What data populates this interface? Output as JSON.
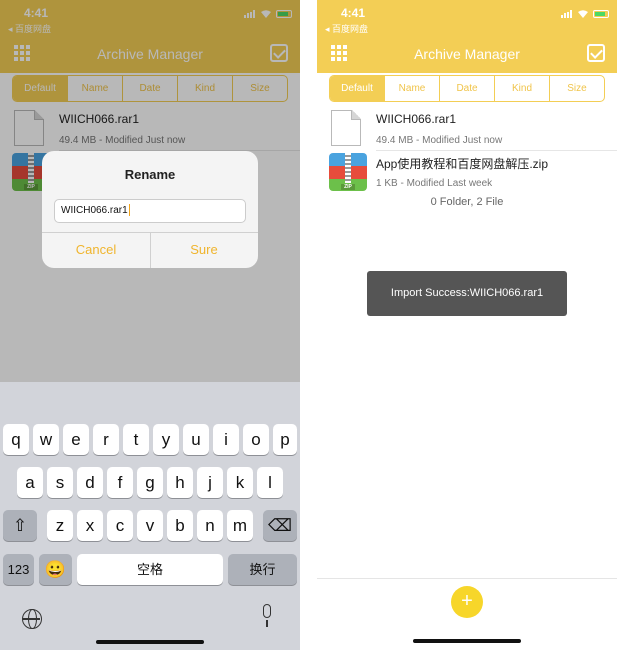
{
  "status_bar": {
    "time": "4:41",
    "back_label": "◂ 百度网盘"
  },
  "app": {
    "title": "Archive Manager"
  },
  "sort_tabs": [
    "Default",
    "Name",
    "Date",
    "Kind",
    "Size"
  ],
  "files": [
    {
      "name": "WIICH066.rar1",
      "meta": "49.4 MB - Modified Just now",
      "icon": "document-icon"
    },
    {
      "name": "App使用教程和百度网盘解压.zip",
      "meta": "1 KB - Modified Last week",
      "icon": "zip-archive-icon"
    }
  ],
  "folder_count": "0 Folder, 2 File",
  "rename_dialog": {
    "title": "Rename",
    "input_value": "WIICH066.rar1",
    "cancel_label": "Cancel",
    "sure_label": "Sure"
  },
  "keyboard": {
    "row1": [
      "q",
      "w",
      "e",
      "r",
      "t",
      "y",
      "u",
      "i",
      "o",
      "p"
    ],
    "row2": [
      "a",
      "s",
      "d",
      "f",
      "g",
      "h",
      "j",
      "k",
      "l"
    ],
    "row3": [
      "z",
      "x",
      "c",
      "v",
      "b",
      "n",
      "m"
    ],
    "numbers_label": "123",
    "emoji_label": "😀",
    "space_label": "空格",
    "return_label": "换行",
    "shift_label": "⇧",
    "delete_label": "⌫"
  },
  "toast": "Import Success:WIICH066.rar1",
  "fab_label": "+",
  "colors": {
    "accent": "#f3ce55",
    "accent_text": "#f0b52e",
    "toast_bg": "#555555",
    "keyboard_bg": "#d2d4da"
  }
}
